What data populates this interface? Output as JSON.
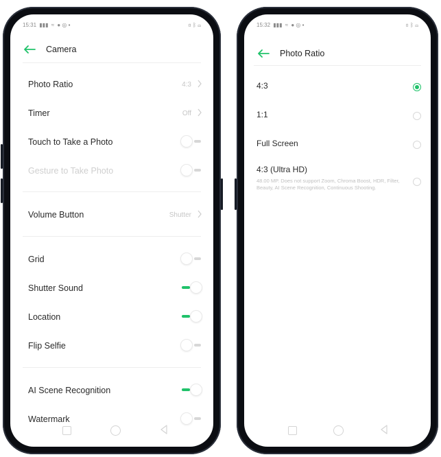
{
  "colors": {
    "accent": "#20c26a",
    "phone_frame": "#0b0d12",
    "text_primary": "#2a2a2a",
    "text_secondary": "#c6c6c6",
    "toggle_off_track": "#d7d7d7"
  },
  "camera_screen": {
    "status_bar": {
      "time": "15:31",
      "left_icons": "signal, wifi, bluetooth, notifications",
      "right_icons": "vibrate, bluetooth, battery"
    },
    "header": {
      "title": "Camera",
      "back_icon": "back-arrow-icon"
    },
    "items": [
      {
        "label": "Photo Ratio",
        "control": "value",
        "value": "4:3"
      },
      {
        "label": "Timer",
        "control": "value",
        "value": "Off"
      },
      {
        "label": "Touch to Take a Photo",
        "control": "toggle",
        "on": false
      },
      {
        "label": "Gesture to Take Photo",
        "control": "toggle",
        "on": false,
        "disabled": true
      },
      {
        "label": "Volume Button",
        "control": "value",
        "value": "Shutter"
      },
      {
        "label": "Grid",
        "control": "toggle",
        "on": false
      },
      {
        "label": "Shutter Sound",
        "control": "toggle",
        "on": true
      },
      {
        "label": "Location",
        "control": "toggle",
        "on": true
      },
      {
        "label": "Flip Selfie",
        "control": "toggle",
        "on": false
      },
      {
        "label": "AI Scene Recognition",
        "control": "toggle",
        "on": true
      },
      {
        "label": "Watermark",
        "control": "toggle",
        "on": false
      }
    ],
    "nav_bar": {
      "icons": [
        "square-icon",
        "circle-icon",
        "triangle-back-icon"
      ]
    }
  },
  "ratio_screen": {
    "status_bar": {
      "time": "15:32",
      "left_icons": "signal, wifi, bluetooth, notifications",
      "right_icons": "vibrate, bluetooth, battery"
    },
    "header": {
      "title": "Photo Ratio",
      "back_icon": "back-arrow-icon"
    },
    "options": [
      {
        "label": "4:3",
        "selected": true,
        "description": ""
      },
      {
        "label": "1:1",
        "selected": false,
        "description": ""
      },
      {
        "label": "Full Screen",
        "selected": false,
        "description": ""
      },
      {
        "label": "4:3 (Ultra HD)",
        "selected": false,
        "description": "48.00 MP. Does not support Zoom, Chroma Boost, HDR, Filter, Beauty, AI Scene Recognition, Continuous Shooting."
      }
    ],
    "nav_bar": {
      "icons": [
        "square-icon",
        "circle-icon",
        "triangle-back-icon"
      ]
    }
  }
}
